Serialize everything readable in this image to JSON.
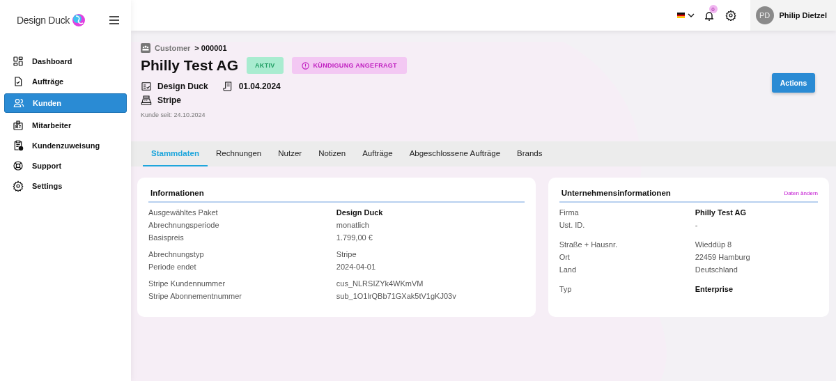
{
  "logo": {
    "text": "Design Duck"
  },
  "sidebar": {
    "items": [
      {
        "label": "Dashboard",
        "selected": false
      },
      {
        "label": "Aufträge",
        "selected": false
      },
      {
        "label": "Kunden",
        "selected": true
      },
      {
        "label": "Mitarbeiter",
        "selected": false
      },
      {
        "label": "Kundenzuweisung",
        "selected": false
      },
      {
        "label": "Support",
        "selected": false
      },
      {
        "label": "Settings",
        "selected": false
      }
    ]
  },
  "topbar": {
    "notifications": "0",
    "user": {
      "initials": "PD",
      "name": "Philip Dietzel"
    }
  },
  "breadcrumb": {
    "parent": "Customer",
    "current": "> 000001"
  },
  "title": "Philly Test AG",
  "badges": [
    {
      "text": "AKTIV",
      "kind": "success"
    },
    {
      "text": "KÜNDIGUNG ANGEFRAGT",
      "kind": "warning"
    }
  ],
  "meta": [
    "Design Duck",
    "01.04.2024",
    "Stripe"
  ],
  "since": "Kunde seit: 24.10.2024",
  "actions_button": "Actions",
  "tabs": [
    {
      "label": "Stammdaten",
      "selected": true
    },
    {
      "label": "Rechnungen",
      "selected": false
    },
    {
      "label": "Nutzer",
      "selected": false
    },
    {
      "label": "Notizen",
      "selected": false
    },
    {
      "label": "Aufträge",
      "selected": false
    },
    {
      "label": "Abgeschlossene Aufträge",
      "selected": false
    },
    {
      "label": "Brands",
      "selected": false
    }
  ],
  "cards": [
    {
      "title": "Informationen",
      "groups": [
        [
          {
            "label": "Ausgewähltes Paket",
            "value": "Design Duck",
            "bold": true
          },
          {
            "label": "Abrechnungsperiode",
            "value": "monatlich",
            "bold": false
          },
          {
            "label": "Basispreis",
            "value": "1.799,00 €",
            "bold": false
          }
        ],
        [
          {
            "label": "Abrechnungstyp",
            "value": "Stripe",
            "bold": false
          },
          {
            "label": "Periode endet",
            "value": "2024-04-01",
            "bold": false
          }
        ],
        [
          {
            "label": "Stripe Kundennummer",
            "value": "cus_NLRSIZYk4WKmVM",
            "bold": false
          },
          {
            "label": "Stripe Abonnementnummer",
            "value": "sub_1O1lrQBb71GXak5tV1gKJ03v",
            "bold": false
          }
        ]
      ]
    },
    {
      "title": "Unternehmensinformationen",
      "link": "Daten ändern",
      "groups": [
        [
          {
            "label": "Firma",
            "value": "Philly Test AG",
            "bold": true
          },
          {
            "label": "Ust. ID.",
            "value": "-",
            "bold": false
          }
        ],
        [
          {
            "label": "Straße + Hausnr.",
            "value": "Wieddüp 8",
            "bold": false
          },
          {
            "label": "Ort",
            "value": "22459 Hamburg",
            "bold": false
          },
          {
            "label": "Land",
            "value": "Deutschland",
            "bold": false
          }
        ],
        [
          {
            "label": "Typ",
            "value": "Enterprise",
            "bold": true
          }
        ]
      ]
    }
  ]
}
